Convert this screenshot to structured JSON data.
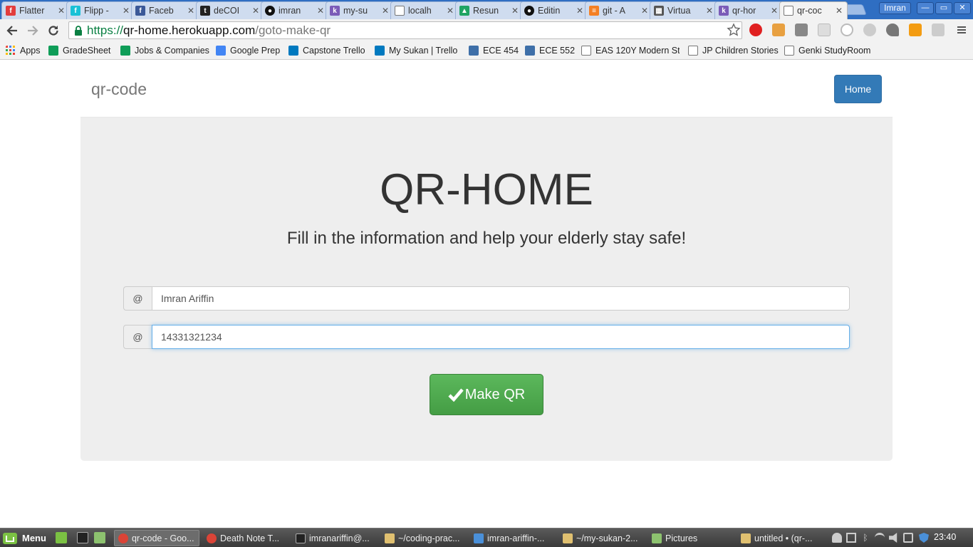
{
  "browser": {
    "tabs": [
      {
        "label": "Flatter",
        "color": "#e23d3d",
        "glyph": "f"
      },
      {
        "label": "Flipp -",
        "color": "#19c1d6",
        "glyph": "f"
      },
      {
        "label": "Faceb",
        "color": "#3b5998",
        "glyph": "f"
      },
      {
        "label": "deCOI",
        "color": "#222222",
        "glyph": "t"
      },
      {
        "label": "imran",
        "color": "#111111",
        "glyph": "◉"
      },
      {
        "label": "my-su",
        "color": "#7b5cb8",
        "glyph": "k"
      },
      {
        "label": "localh",
        "color": "#ffffff",
        "glyph": "▯"
      },
      {
        "label": "Resun",
        "color": "#1fa463",
        "glyph": "▲"
      },
      {
        "label": "Editin",
        "color": "#111111",
        "glyph": "◉"
      },
      {
        "label": "git - A",
        "color": "#f48024",
        "glyph": "≡"
      },
      {
        "label": "Virtua",
        "color": "#555555",
        "glyph": "▦"
      },
      {
        "label": "qr-hor",
        "color": "#7b5cb8",
        "glyph": "k"
      },
      {
        "label": "qr-coc",
        "color": "#ffffff",
        "glyph": "▯"
      }
    ],
    "profile_name": "Imran",
    "window_buttons": {
      "minimize": "—",
      "maximize": "▭",
      "close": "✕"
    },
    "url": {
      "scheme": "https://",
      "host": "qr-home.herokuapp.com",
      "path": "/goto-make-qr"
    },
    "bookmarks": [
      {
        "label": "Apps",
        "color": "#e94235"
      },
      {
        "label": "GradeSheet",
        "color": "#0f9d58"
      },
      {
        "label": "Jobs & Companies",
        "color": "#0f9d58"
      },
      {
        "label": "Google Prep",
        "color": "#4285f4"
      },
      {
        "label": "Capstone Trello",
        "color": "#0079bf"
      },
      {
        "label": "My Sukan | Trello",
        "color": "#0079bf"
      },
      {
        "label": "ECE 454",
        "color": "#3e6fa8"
      },
      {
        "label": "ECE 552",
        "color": "#3e6fa8"
      },
      {
        "label": "EAS 120Y Modern St",
        "color": "#ffffff"
      },
      {
        "label": "JP Children Stories",
        "color": "#ffffff"
      },
      {
        "label": "Genki StudyRoom",
        "color": "#ffffff"
      }
    ]
  },
  "page": {
    "brand": "qr-code",
    "home_label": "Home",
    "headline": "QR-HOME",
    "subhead": "Fill in the information and help your elderly stay safe!",
    "name_addon": "@",
    "name_value": "Imran Ariffin",
    "phone_addon": "@",
    "phone_value": "14331321234",
    "make_qr_label": "Make QR",
    "primary_color": "#337ab7",
    "success_color": "#5cb85c"
  },
  "taskbar": {
    "menu_label": "Menu",
    "items": [
      {
        "label": "qr-code - Goo...",
        "color": "#db4437",
        "active": true
      },
      {
        "label": "Death Note T...",
        "color": "#db4437",
        "active": false
      },
      {
        "label": "imranariffin@...",
        "color": "#222222",
        "active": false
      },
      {
        "label": "~/coding-prac...",
        "color": "#e0c070",
        "active": false
      },
      {
        "label": "imran-ariffin-...",
        "color": "#4a90d9",
        "active": false
      },
      {
        "label": "~/my-sukan-2...",
        "color": "#e0c070",
        "active": false
      },
      {
        "label": "Pictures",
        "color": "#8dc26f",
        "active": false
      },
      {
        "label": "untitled • (qr-...",
        "color": "#e0c070",
        "active": false
      }
    ],
    "clock": "23:40"
  }
}
